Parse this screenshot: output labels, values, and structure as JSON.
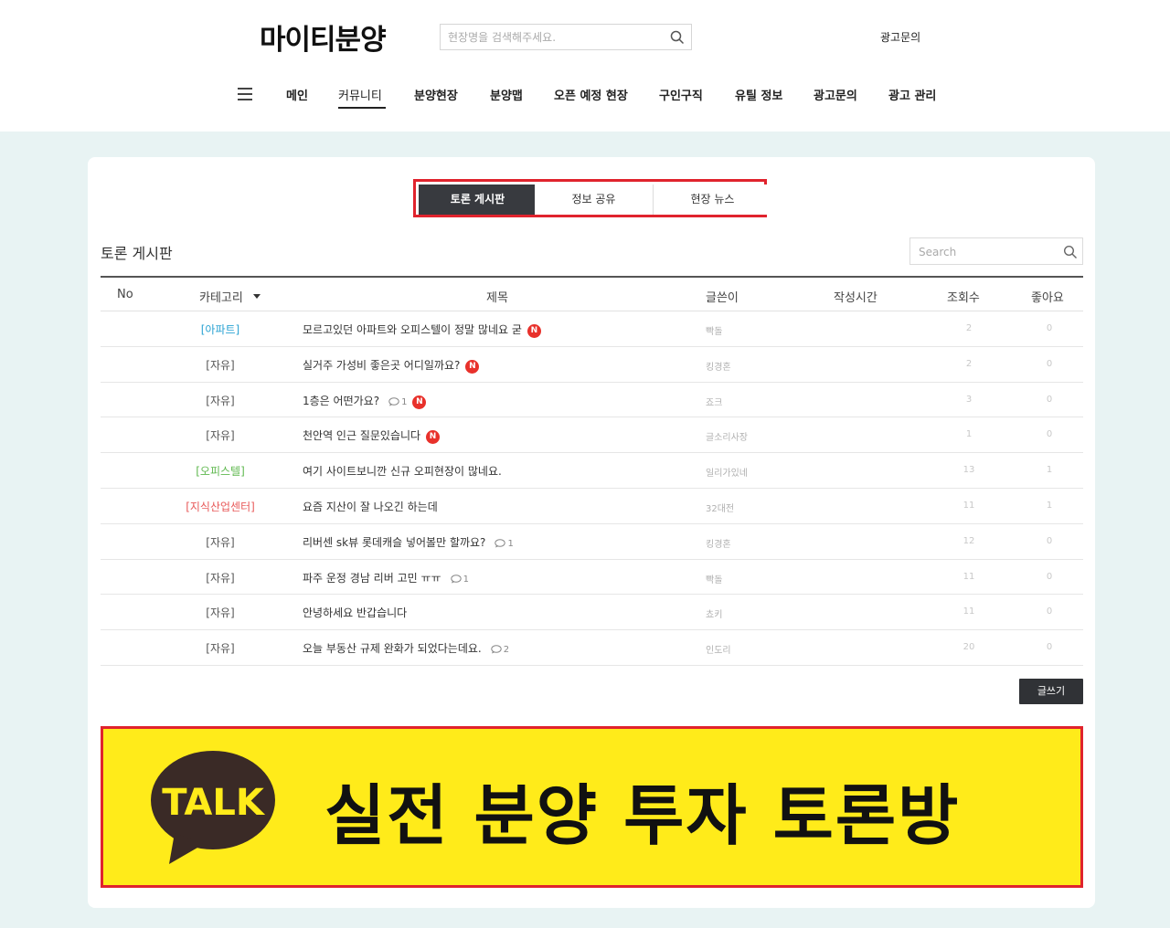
{
  "header": {
    "logo": "마이티분양",
    "search_placeholder": "현장명을 검색해주세요.",
    "ad_link": "광고문의"
  },
  "nav": {
    "items": [
      {
        "label": "메인"
      },
      {
        "label": "커뮤니티"
      },
      {
        "label": "분양현장"
      },
      {
        "label": "분양맵"
      },
      {
        "label": "오픈 예정 현장"
      },
      {
        "label": "구인구직"
      },
      {
        "label": "유틸 정보"
      },
      {
        "label": "광고문의"
      },
      {
        "label": "광고 관리"
      }
    ],
    "active": "커뮤니티"
  },
  "tabs": [
    {
      "label": "토론 게시판",
      "active": true
    },
    {
      "label": "정보 공유",
      "active": false
    },
    {
      "label": "현장 뉴스",
      "active": false
    }
  ],
  "board": {
    "title": "토론 게시판",
    "search_placeholder": "Search",
    "columns": {
      "no": "No",
      "category": "카테고리",
      "subject": "제목",
      "author": "글쓴이",
      "time": "작성시간",
      "views": "조회수",
      "likes": "좋아요"
    },
    "rows": [
      {
        "category": "[아파트]",
        "cat_type": "apt",
        "subject": "모르고있던 아파트와 오피스텔이 정말 많네요 굳",
        "comments": "",
        "new": true,
        "author": "빡돌",
        "views": "2",
        "likes": "0"
      },
      {
        "category": "[자유]",
        "cat_type": "free",
        "subject": "실거주 가성비 좋은곳 어디일까요?",
        "comments": "",
        "new": true,
        "author": "킹경혼",
        "views": "2",
        "likes": "0"
      },
      {
        "category": "[자유]",
        "cat_type": "free",
        "subject": "1층은 어떤가요?",
        "comments": "1",
        "new": true,
        "author": "죠크",
        "views": "3",
        "likes": "0"
      },
      {
        "category": "[자유]",
        "cat_type": "free",
        "subject": "천안역 인근 질문있습니다",
        "comments": "",
        "new": true,
        "author": "글소리사장",
        "views": "1",
        "likes": "0"
      },
      {
        "category": "[오피스텔]",
        "cat_type": "office",
        "subject": "여기 사이트보니깐 신규 오피현장이 많네요.",
        "comments": "",
        "new": false,
        "author": "일리가있네",
        "views": "13",
        "likes": "1"
      },
      {
        "category": "[지식산업센터]",
        "cat_type": "industry",
        "subject": "요즘 지산이 잘 나오긴 하는데",
        "comments": "",
        "new": false,
        "author": "32대전",
        "views": "11",
        "likes": "1"
      },
      {
        "category": "[자유]",
        "cat_type": "free",
        "subject": "리버센 sk뷰 롯데캐슬 넣어볼만 할까요?",
        "comments": "1",
        "new": false,
        "author": "킹경혼",
        "views": "12",
        "likes": "0"
      },
      {
        "category": "[자유]",
        "cat_type": "free",
        "subject": "파주 운정 경남 리버 고민 ㅠㅠ",
        "comments": "1",
        "new": false,
        "author": "빡돌",
        "views": "11",
        "likes": "0"
      },
      {
        "category": "[자유]",
        "cat_type": "free",
        "subject": "안녕하세요 반갑습니다",
        "comments": "",
        "new": false,
        "author": "쵸키",
        "views": "11",
        "likes": "0"
      },
      {
        "category": "[자유]",
        "cat_type": "free",
        "subject": "오늘 부동산 규제 완화가 되었다는데요.",
        "comments": "2",
        "new": false,
        "author": "인도리",
        "views": "20",
        "likes": "0"
      }
    ],
    "new_badge": "N",
    "write_button": "글쓰기"
  },
  "banner": {
    "talk_label": "TALK",
    "text": "실전 분양 투자 토론방"
  },
  "colors": {
    "accent_red": "#e0232d",
    "banner_yellow": "#ffeb1a",
    "tab_dark": "#383a3f",
    "page_bg": "#e8f3f3"
  }
}
